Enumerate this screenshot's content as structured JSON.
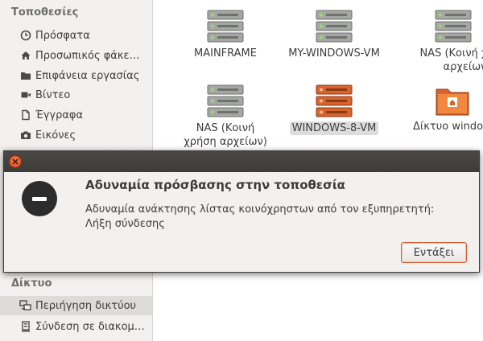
{
  "sidebar": {
    "places_header": "Τοποθεσίες",
    "places": [
      {
        "label": "Πρόσφατα",
        "icon": "clock-icon"
      },
      {
        "label": "Προσωπικός φάκε…",
        "icon": "home-icon"
      },
      {
        "label": "Επιφάνεια εργασίας",
        "icon": "folder-icon"
      },
      {
        "label": "Βίντεο",
        "icon": "video-icon"
      },
      {
        "label": "Έγγραφα",
        "icon": "document-icon"
      },
      {
        "label": "Εικόνες",
        "icon": "camera-icon"
      }
    ],
    "network_header": "Δίκτυο",
    "network": [
      {
        "label": "Περιήγηση δικτύου",
        "icon": "network-icon"
      },
      {
        "label": "Σύνδεση σε διακομ…",
        "icon": "server-connect-icon"
      }
    ]
  },
  "files": [
    {
      "name": "MAINFRAME",
      "icon": "server-icon"
    },
    {
      "name": "MY-WINDOWS-VM",
      "icon": "server-icon"
    },
    {
      "name": "NAS (Κοινή χρήση αρχείων)",
      "icon": "server-icon"
    },
    {
      "name": "NAS (Κοινή χρήση αρχείων)",
      "icon": "server-icon"
    },
    {
      "name": "WINDOWS-8-VM",
      "icon": "server-icon"
    },
    {
      "name": "Δίκτυο windows",
      "icon": "network-folder-icon"
    }
  ],
  "dialog": {
    "title": "Αδυναμία πρόσβασης στην τοποθεσία",
    "message": "Αδυναμία ανάκτησης λίστας κοινόχρηστων από τον εξυπηρετητή: Λήξη σύνδεσης",
    "ok_label": "Εντάξει"
  },
  "colors": {
    "accent": "#d75b2f",
    "titlebar": "#3c3b37",
    "server_grey": "#9a9c98",
    "server_orange": "#d5642f"
  }
}
